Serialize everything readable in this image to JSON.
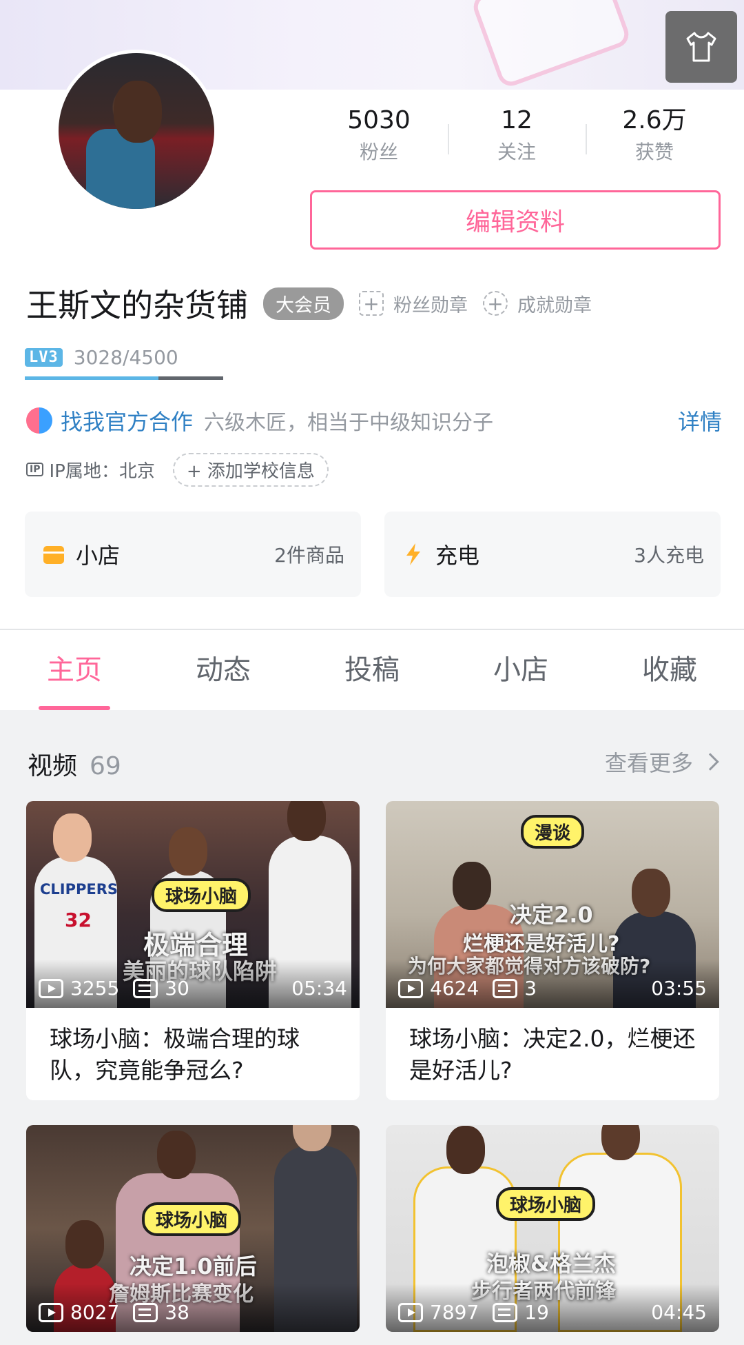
{
  "profile": {
    "username": "王斯文的杂货铺",
    "vip_badge": "大会员",
    "fan_medal": "粉丝勋章",
    "achievement_medal": "成就勋章",
    "level_badge": "LV3",
    "exp": "3028/4500",
    "exp_ratio": 0.673,
    "edit_button": "编辑资料",
    "stats": [
      {
        "num": "5030",
        "label": "粉丝"
      },
      {
        "num": "12",
        "label": "关注"
      },
      {
        "num": "2.6万",
        "label": "获赞"
      }
    ],
    "coop_link": "找我官方合作",
    "bio": "六级木匠，相当于中级知识分子",
    "coop_more": "详情",
    "ip_icon": "IP",
    "ip_location": "IP属地：北京",
    "add_school": "添加学校信息"
  },
  "cards": {
    "shop": {
      "title": "小店",
      "count": "2件商品"
    },
    "charge": {
      "title": "充电",
      "count": "3人充电"
    }
  },
  "tabs": [
    "主页",
    "动态",
    "投稿",
    "小店",
    "收藏"
  ],
  "videos_section": {
    "title": "视频",
    "count": "69",
    "more": "查看更多"
  },
  "videos": [
    {
      "tag": "球场小脑",
      "overlay1": "极端合理",
      "overlay2": "美丽的球队陷阱",
      "jersey1": "CLIPPERS",
      "num1": "32",
      "plays": "3255",
      "danmaku": "30",
      "duration": "05:34",
      "title": "球场小脑：极端合理的球队，究竟能争冠么?"
    },
    {
      "tag": "漫谈",
      "overlay1": "决定2.0",
      "overlay2": "烂梗还是好活儿?",
      "overlay3": "为何大家都觉得对方该破防?",
      "plays": "4624",
      "danmaku": "3",
      "duration": "03:55",
      "title": "球场小脑：决定2.0，烂梗还是好活儿?"
    },
    {
      "tag": "球场小脑",
      "overlay1": "决定1.0前后",
      "overlay2": "詹姆斯比赛变化",
      "plays": "8027",
      "danmaku": "38",
      "duration": "",
      "title": ""
    },
    {
      "tag": "球场小脑",
      "overlay1": "泡椒&格兰杰",
      "overlay2": "步行者两代前锋",
      "plays": "7897",
      "danmaku": "19",
      "duration": "04:45",
      "title": ""
    }
  ],
  "colors": {
    "accent": "#ff6699",
    "link": "#2f80c4",
    "level": "#5cb6e6"
  }
}
